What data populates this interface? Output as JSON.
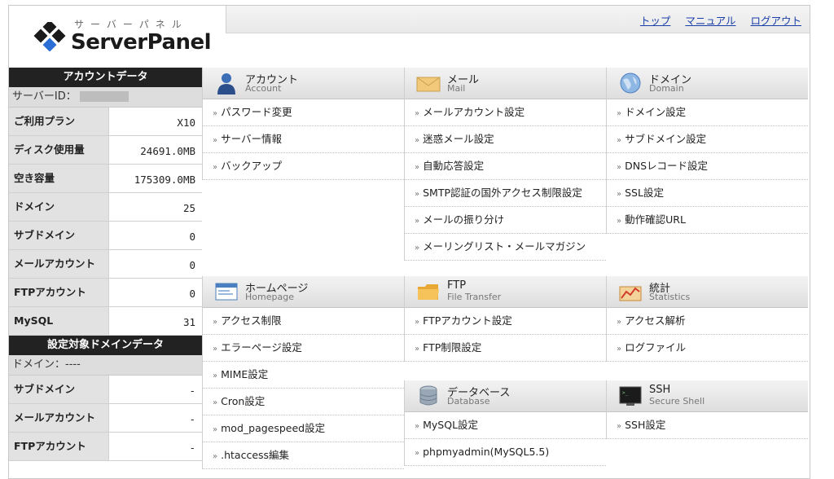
{
  "logo": {
    "kana": "サーバーパネル",
    "name": "ServerPanel"
  },
  "header": {
    "links": [
      "トップ",
      "マニュアル",
      "ログアウト"
    ]
  },
  "account": {
    "heading": "アカウントデータ",
    "server_id_label": "サーバーID：",
    "rows": [
      {
        "label": "ご利用プラン",
        "value": "X10"
      },
      {
        "label": "ディスク使用量",
        "value": "24691.0MB"
      },
      {
        "label": "空き容量",
        "value": "175309.0MB"
      },
      {
        "label": "ドメイン",
        "value": "25"
      },
      {
        "label": "サブドメイン",
        "value": "0"
      },
      {
        "label": "メールアカウント",
        "value": "0"
      },
      {
        "label": "FTPアカウント",
        "value": "0"
      },
      {
        "label": "MySQL",
        "value": "31"
      }
    ]
  },
  "domain_data": {
    "heading": "設定対象ドメインデータ",
    "domain_label": "ドメイン：----",
    "rows": [
      {
        "label": "サブドメイン",
        "value": "-"
      },
      {
        "label": "メールアカウント",
        "value": "-"
      },
      {
        "label": "FTPアカウント",
        "value": "-"
      }
    ]
  },
  "sections": {
    "account": {
      "title": "アカウント",
      "subtitle": "Account",
      "items": [
        "パスワード変更",
        "サーバー情報",
        "バックアップ"
      ]
    },
    "mail": {
      "title": "メール",
      "subtitle": "Mail",
      "items": [
        "メールアカウント設定",
        "迷惑メール設定",
        "自動応答設定",
        "SMTP認証の国外アクセス制限設定",
        "メールの振り分け",
        "メーリングリスト・メールマガジン"
      ]
    },
    "domain": {
      "title": "ドメイン",
      "subtitle": "Domain",
      "items": [
        "ドメイン設定",
        "サブドメイン設定",
        "DNSレコード設定",
        "SSL設定",
        "動作確認URL"
      ]
    },
    "homepage": {
      "title": "ホームページ",
      "subtitle": "Homepage",
      "items": [
        "アクセス制限",
        "エラーページ設定",
        "MIME設定",
        "Cron設定",
        "mod_pagespeed設定",
        ".htaccess編集"
      ]
    },
    "ftp": {
      "title": "FTP",
      "subtitle": "File Transfer",
      "items": [
        "FTPアカウント設定",
        "FTP制限設定"
      ]
    },
    "stats": {
      "title": "統計",
      "subtitle": "Statistics",
      "items": [
        "アクセス解析",
        "ログファイル"
      ]
    },
    "database": {
      "title": "データベース",
      "subtitle": "Database",
      "items": [
        "MySQL設定",
        "phpmyadmin(MySQL5.5)"
      ]
    },
    "ssh": {
      "title": "SSH",
      "subtitle": "Secure Shell",
      "items": [
        "SSH設定"
      ]
    }
  },
  "arrow_glyph": "»"
}
